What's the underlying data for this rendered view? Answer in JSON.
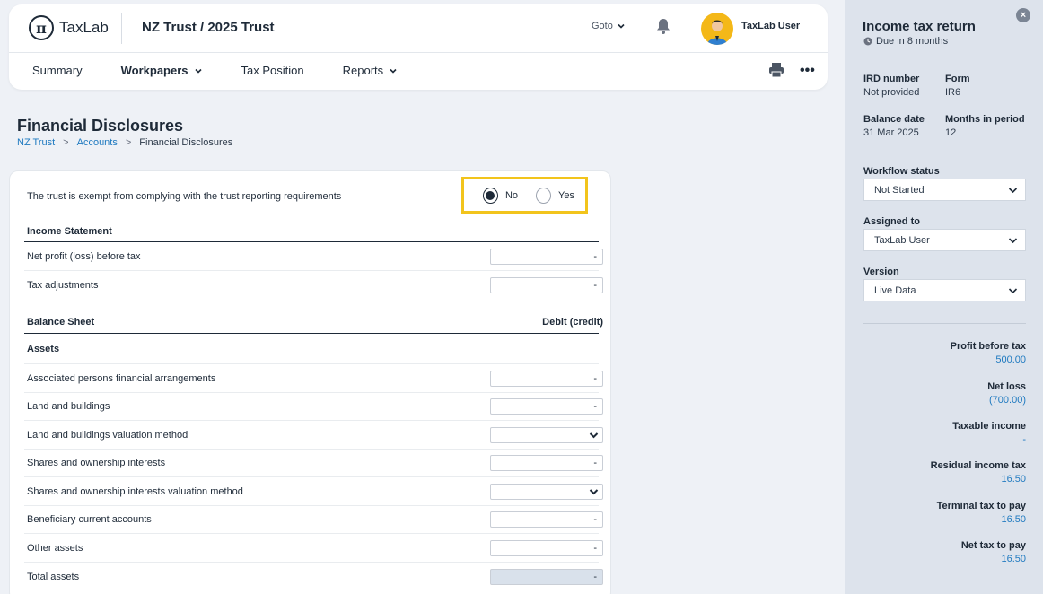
{
  "header": {
    "logo_symbol": "π",
    "logo_text": "TaxLab",
    "title": "NZ Trust / 2025 Trust",
    "goto_label": "Goto",
    "user_name": "TaxLab User"
  },
  "nav": {
    "items": [
      {
        "label": "Summary"
      },
      {
        "label": "Workpapers"
      },
      {
        "label": "Tax Position"
      },
      {
        "label": "Reports"
      }
    ],
    "more_label": "•••"
  },
  "page": {
    "title": "Financial Disclosures",
    "breadcrumb": [
      "NZ Trust",
      "Accounts",
      "Financial Disclosures"
    ],
    "breadcrumb_sep": ">"
  },
  "form": {
    "exempt_question": "The trust is exempt from complying with the trust reporting requirements",
    "radio_no": "No",
    "radio_yes": "Yes",
    "selected": "No",
    "income_statement": "Income Statement",
    "net_profit_label": "Net profit (loss) before tax",
    "net_profit_value": "-",
    "tax_adj_label": "Tax adjustments",
    "tax_adj_value": "-",
    "balance_sheet": "Balance Sheet",
    "debit_credit": "Debit (credit)",
    "assets": "Assets",
    "rows": [
      {
        "label": "Associated persons financial arrangements",
        "value": "-"
      },
      {
        "label": "Land and buildings",
        "value": "-"
      },
      {
        "label": "Land and buildings valuation method",
        "value": ""
      },
      {
        "label": "Shares and ownership interests",
        "value": "-"
      },
      {
        "label": "Shares and ownership interests valuation method",
        "value": ""
      },
      {
        "label": "Beneficiary current accounts",
        "value": "-"
      },
      {
        "label": "Other assets",
        "value": "-"
      },
      {
        "label": "Total assets",
        "value": "-"
      }
    ]
  },
  "panel": {
    "close_label": "×",
    "title": "Income tax return",
    "due": "Due in 8 months",
    "ird_label": "IRD number",
    "ird_value": "Not provided",
    "form_label": "Form",
    "form_value": "IR6",
    "balance_label": "Balance date",
    "balance_value": "31 Mar 2025",
    "months_label": "Months in period",
    "months_value": "12",
    "workflow_label": "Workflow status",
    "workflow_value": "Not Started",
    "assigned_label": "Assigned to",
    "assigned_value": "TaxLab User",
    "version_label": "Version",
    "version_value": "Live Data",
    "summary": [
      {
        "label": "Profit before tax",
        "value": "500.00"
      },
      {
        "label": "Net loss",
        "value": "(700.00)"
      },
      {
        "label": "Taxable income",
        "value": "-"
      },
      {
        "label": "Residual income tax",
        "value": "16.50"
      },
      {
        "label": "Terminal tax to pay",
        "value": "16.50"
      },
      {
        "label": "Net tax to pay",
        "value": "16.50"
      }
    ]
  },
  "colors": {
    "accent_link": "#1f7ac0",
    "highlight": "#f2c41c",
    "avatar_bg": "#f4b818",
    "panel_bg": "#dde3ec"
  },
  "icons": [
    "bell-icon",
    "printer-icon",
    "chevron-down-icon",
    "clock-icon",
    "close-icon"
  ]
}
